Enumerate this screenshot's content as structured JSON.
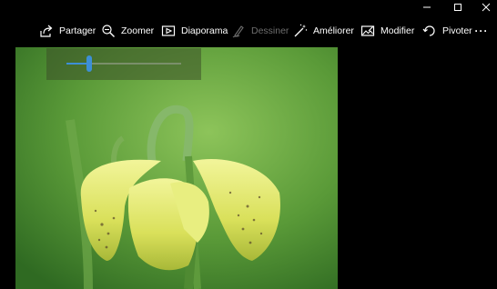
{
  "window_controls": {
    "minimize_icon": "minimize-icon",
    "maximize_icon": "maximize-icon",
    "close_icon": "close-icon"
  },
  "toolbar": {
    "share_label": "Partager",
    "zoom_label": "Zoomer",
    "slideshow_label": "Diaporama",
    "draw_label": "Dessiner",
    "enhance_label": "Améliorer",
    "edit_label": "Modifier",
    "rotate_label": "Pivoter",
    "more_label": "···"
  },
  "zoom_panel": {
    "slider_value": 0.2
  },
  "colors": {
    "accent": "#3d8fd6",
    "background": "#000000",
    "disabled_text": "#6e6e6e"
  }
}
